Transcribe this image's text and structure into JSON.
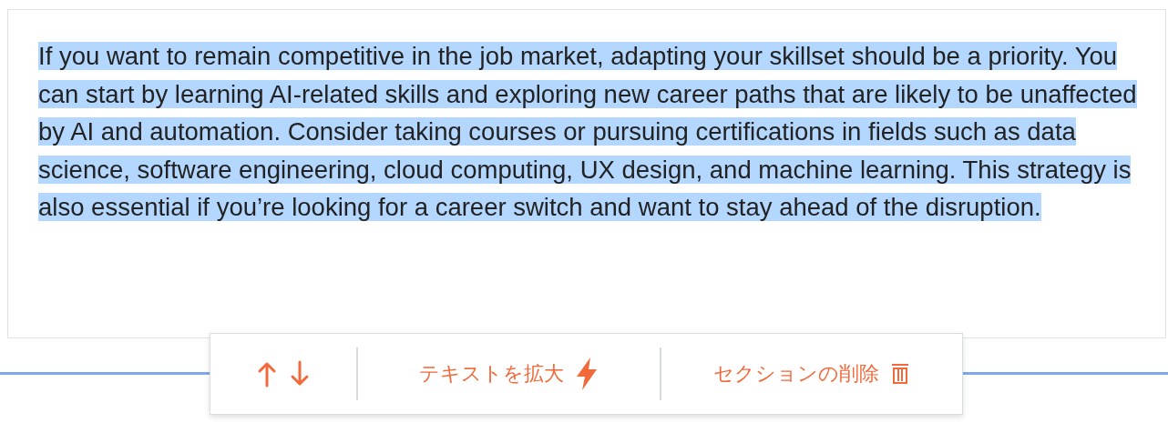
{
  "section": {
    "text": "If you want to remain competitive in the job market, adapting your skillset should be a priority. You can start by learning AI-related skills and exploring new career paths that are likely to be unaffected by AI and automation. Consider taking courses or pursuing certifications in fields such as data science, software engineering, cloud computing, UX design, and machine learning. This strategy is also essential if you’re looking for a career switch and want to stay ahead of the disruption.",
    "selected": true
  },
  "toolbar": {
    "expand_label": "テキストを拡大",
    "delete_label": "セクションの削除"
  }
}
